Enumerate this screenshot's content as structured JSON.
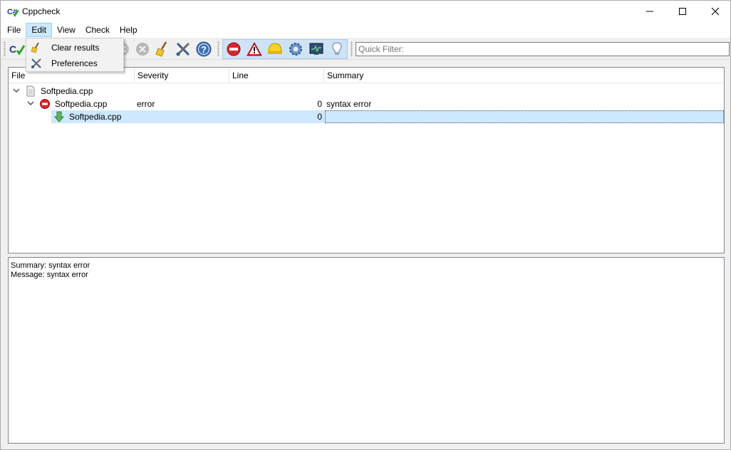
{
  "window": {
    "title": "Cppcheck",
    "app_icon_text": "C#"
  },
  "menubar": {
    "items": [
      {
        "label": "File"
      },
      {
        "label": "Edit"
      },
      {
        "label": "View"
      },
      {
        "label": "Check"
      },
      {
        "label": "Help"
      }
    ]
  },
  "edit_menu": {
    "items": [
      {
        "label": "Clear results",
        "icon": "broom-icon"
      },
      {
        "label": "Preferences",
        "icon": "tools-icon"
      }
    ]
  },
  "toolbar": {
    "buttons": [
      "check-icon",
      "stop-icon",
      "clear-icon",
      "preferences-icon",
      "help-icon"
    ],
    "filters": [
      "show-errors-icon",
      "show-warnings-icon",
      "show-style-icon",
      "show-portability-icon",
      "show-performance-icon",
      "show-information-icon"
    ],
    "quick_filter_placeholder": "Quick Filter:"
  },
  "results": {
    "columns": [
      "File",
      "Severity",
      "Line",
      "Summary"
    ],
    "rows": [
      {
        "file": "Softpedia.cpp",
        "severity": "",
        "line": "",
        "summary": ""
      },
      {
        "file": "Softpedia.cpp",
        "severity": "error",
        "line": "0",
        "summary": "syntax error"
      },
      {
        "file": "Softpedia.cpp",
        "severity": "",
        "line": "0",
        "summary": ""
      }
    ]
  },
  "details": {
    "summary": "Summary: syntax error",
    "message": "Message: syntax error"
  },
  "colors": {
    "selection": "#cde8ff",
    "menu_active": "#cce8ff",
    "error_red": "#d9262c"
  }
}
